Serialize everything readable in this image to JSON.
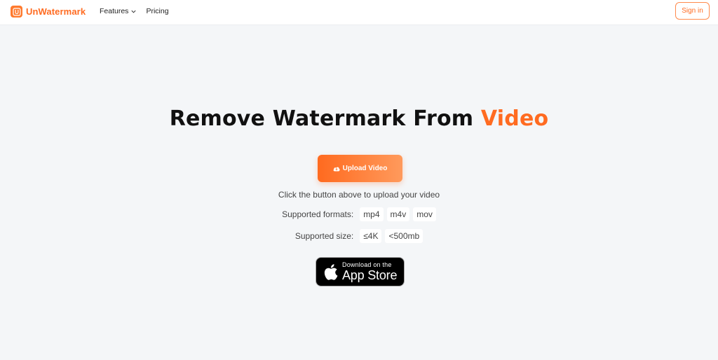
{
  "header": {
    "logo_letter": "U",
    "logo_text": "UnWatermark",
    "nav": {
      "features": "Features",
      "pricing": "Pricing"
    },
    "signin": "Sign in"
  },
  "hero": {
    "title_main": "Remove Watermark From ",
    "title_accent": "Video",
    "upload_label": "Upload Video",
    "hint": "Click the button above to upload your video",
    "formats_label": "Supported formats:",
    "formats": [
      "mp4",
      "m4v",
      "mov"
    ],
    "size_label": "Supported size:",
    "sizes": [
      "≤4K",
      "<500mb"
    ]
  },
  "appstore": {
    "small": "Download on the",
    "big": "App Store"
  },
  "colors": {
    "accent": "#ff6b21",
    "background": "#f4f6f8",
    "text": "#222222"
  },
  "icons": {
    "upload": "cloud-upload-icon",
    "apple": "apple-icon",
    "features_dropdown": "chevron-down-icon"
  }
}
